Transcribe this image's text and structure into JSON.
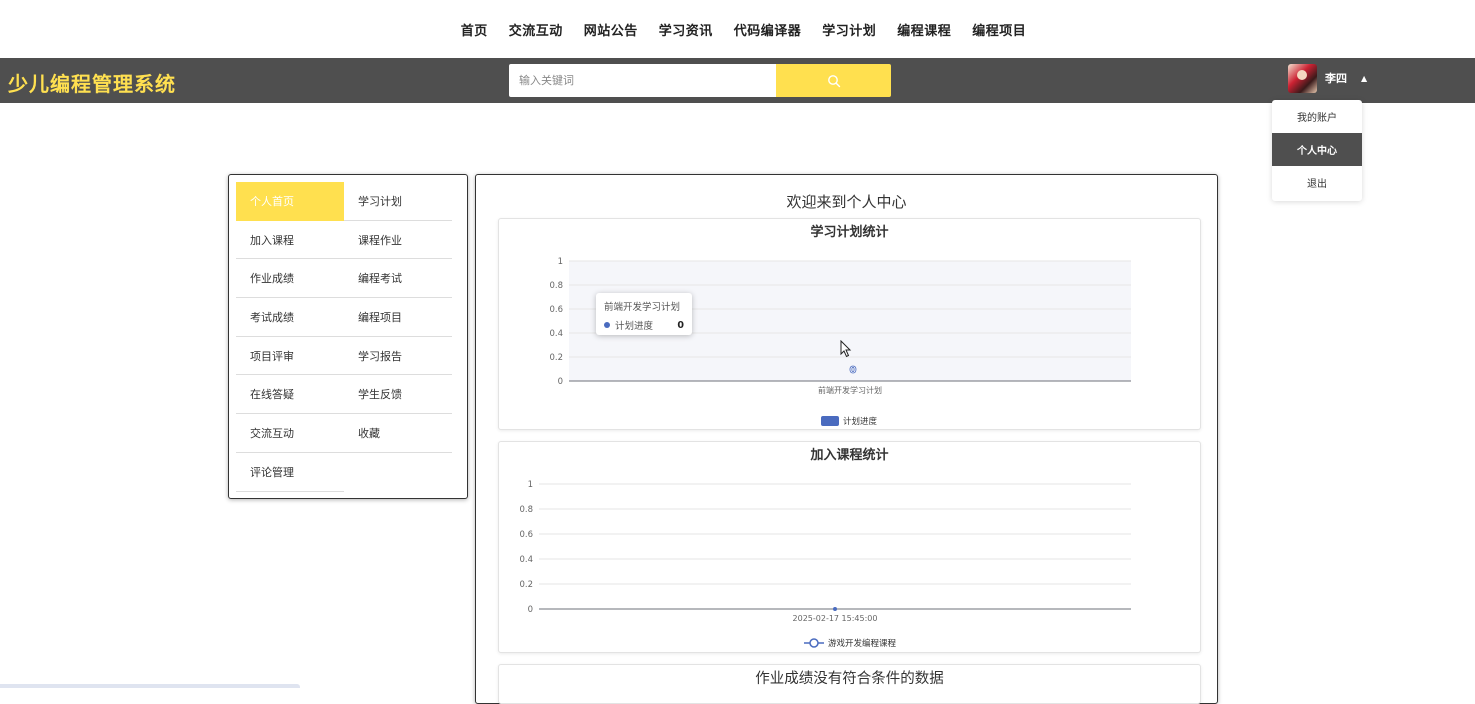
{
  "nav": {
    "items": [
      "首页",
      "交流互动",
      "网站公告",
      "学习资讯",
      "代码编译器",
      "学习计划",
      "编程课程",
      "编程项目"
    ]
  },
  "header": {
    "brand": "少儿编程管理系统",
    "search_placeholder": "输入关键词",
    "user_name": "李四",
    "caret": "▲"
  },
  "dropdown": {
    "items": [
      "我的账户",
      "个人中心",
      "退出"
    ],
    "active_index": 1
  },
  "sidebar": {
    "items": [
      "个人首页",
      "学习计划",
      "加入课程",
      "课程作业",
      "作业成绩",
      "编程考试",
      "考试成绩",
      "编程项目",
      "项目评审",
      "学习报告",
      "在线答疑",
      "学生反馈",
      "交流互动",
      "收藏",
      "评论管理"
    ],
    "active_index": 0
  },
  "main": {
    "welcome": "欢迎来到个人中心",
    "chart1_title": "学习计划统计",
    "chart2_title": "加入课程统计",
    "empty_message": "作业成绩没有符合条件的数据",
    "tooltip": {
      "title": "前端开发学习计划",
      "label": "计划进度",
      "value": "0"
    }
  },
  "colors": {
    "accent": "#ffe04f",
    "header_bg": "#4f4f4f",
    "series": "#4a6bbf"
  },
  "chart_data": [
    {
      "type": "bar",
      "title": "学习计划统计",
      "categories": [
        "前端开发学习计划"
      ],
      "series": [
        {
          "name": "计划进度",
          "values": [
            0
          ]
        }
      ],
      "y_ticks": [
        "1",
        "0.8",
        "0.6",
        "0.4",
        "0.2",
        "0"
      ],
      "ylim": [
        0,
        1
      ],
      "data_label": "0",
      "legend": "bottom-center",
      "grid": true
    },
    {
      "type": "line",
      "title": "加入课程统计",
      "categories": [
        "2025-02-17 15:45:00"
      ],
      "series": [
        {
          "name": "游戏开发编程课程",
          "values": [
            0
          ]
        }
      ],
      "y_ticks": [
        "1",
        "0.8",
        "0.6",
        "0.4",
        "0.2",
        "0"
      ],
      "ylim": [
        0,
        1
      ],
      "legend": "bottom-center",
      "grid": true
    }
  ]
}
